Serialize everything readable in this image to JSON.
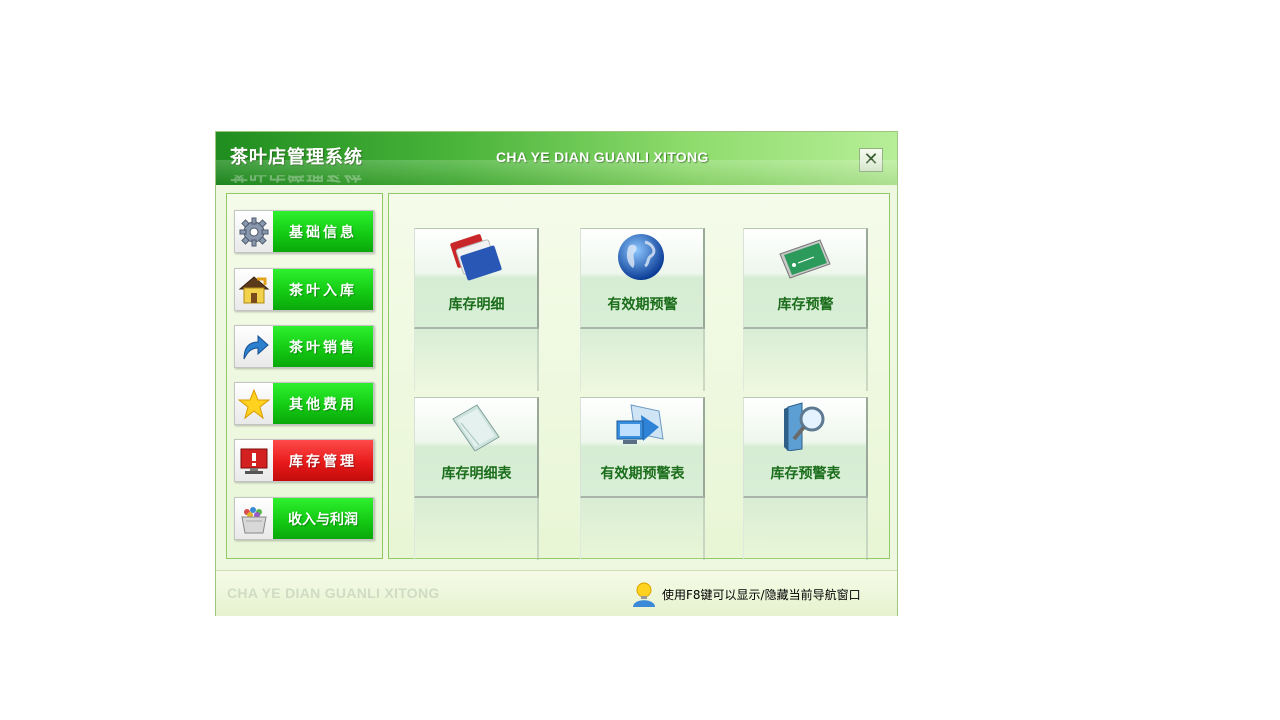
{
  "window": {
    "title_cn": "茶叶店管理系统",
    "title_en": "CHA YE DIAN GUANLI XITONG",
    "close_symbol": "✕"
  },
  "sidebar": {
    "items": [
      {
        "label": "基础信息",
        "icon": "gear-icon",
        "active": false
      },
      {
        "label": "茶叶入库",
        "icon": "house-icon",
        "active": false
      },
      {
        "label": "茶叶销售",
        "icon": "arrow-icon",
        "active": false
      },
      {
        "label": "其他费用",
        "icon": "star-icon",
        "active": false
      },
      {
        "label": "库存管理",
        "icon": "alert-monitor-icon",
        "active": true
      },
      {
        "label": "收入与利润",
        "icon": "basket-icon",
        "active": false
      }
    ]
  },
  "main": {
    "tiles": [
      {
        "label": "库存明细",
        "icon": "folders-icon"
      },
      {
        "label": "有效期预警",
        "icon": "globe-icon"
      },
      {
        "label": "库存预警",
        "icon": "card-icon"
      },
      {
        "label": "库存明细表",
        "icon": "glass-sheet-icon"
      },
      {
        "label": "有效期预警表",
        "icon": "computer-window-icon"
      },
      {
        "label": "库存预警表",
        "icon": "magnifier-book-icon"
      }
    ]
  },
  "footer": {
    "brand_en": "CHA YE DIAN GUANLI XITONG",
    "tip": "使用F8键可以显示/隐藏当前导航窗口",
    "tip_icon": "lightbulb-user-icon"
  },
  "colors": {
    "title_green": "#1f8d1f",
    "nav_green": "#14cb14",
    "nav_active_red": "#e81a1a",
    "tile_text": "#1a6d1a"
  }
}
